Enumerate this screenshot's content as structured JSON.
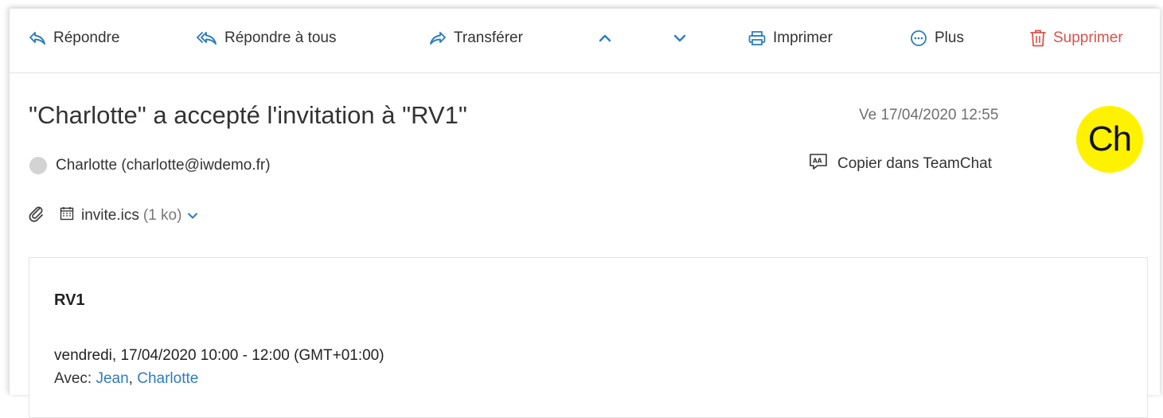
{
  "toolbar": {
    "reply_label": "Répondre",
    "reply_all_label": "Répondre à tous",
    "forward_label": "Transférer",
    "print_label": "Imprimer",
    "more_label": "Plus",
    "delete_label": "Supprimer",
    "icons": [
      "reply-icon",
      "reply-all-icon",
      "forward-icon",
      "chevron-up-icon",
      "chevron-down-icon",
      "printer-icon",
      "more-icon",
      "trash-icon"
    ]
  },
  "message": {
    "subject": "\"Charlotte\" a accepté l'invitation à \"RV1\"",
    "date": "Ve 17/04/2020 12:55",
    "avatar_initials": "Ch",
    "sender": "Charlotte (charlotte@iwdemo.fr)",
    "copy_teamchat_label": "Copier dans TeamChat"
  },
  "attachment": {
    "name": "invite.ics",
    "size": "(1 ko)"
  },
  "invitation": {
    "title": "RV1",
    "time": "vendredi, 17/04/2020 10:00 - 12:00 (GMT+01:00)",
    "with_label": "Avec:",
    "attendees": [
      "Jean",
      "Charlotte"
    ],
    "separator": ","
  },
  "colors": {
    "accent": "#2d7dbd",
    "delete": "#d9534f",
    "avatar_bg": "#fff200",
    "status_dot": "#d3d3d3"
  }
}
